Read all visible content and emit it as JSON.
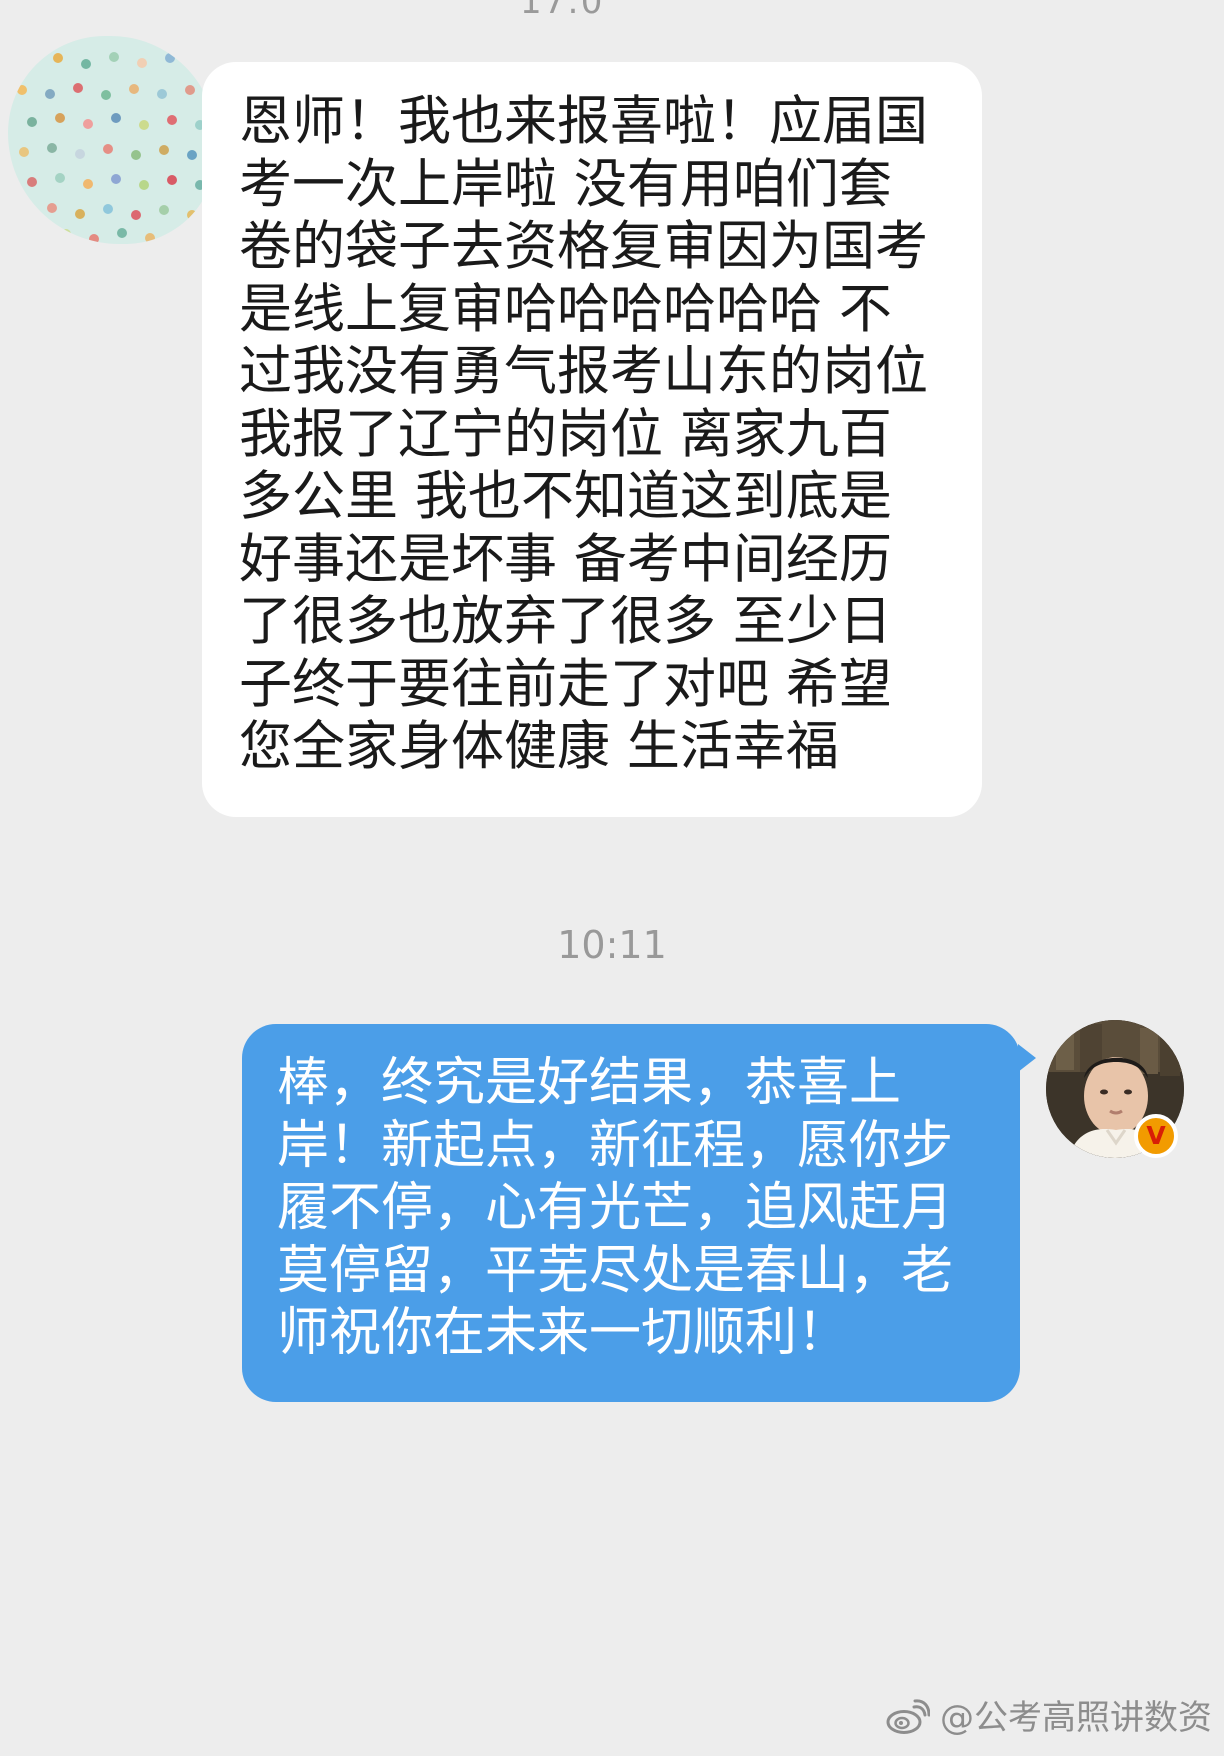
{
  "top_fragment": "17:0",
  "conversation": {
    "incoming": {
      "avatar": "polka-dot-avatar",
      "text": "恩师！我也来报喜啦！应届国考一次上岸啦 没有用咱们套卷的袋子去资格复审因为国考是线上复审哈哈哈哈哈哈 不过我没有勇气报考山东的岗位 我报了辽宁的岗位 离家九百多公里 我也不知道这到底是好事还是坏事 备考中间经历了很多也放弃了很多 至少日子终于要往前走了对吧 希望您全家身体健康 生活幸福"
    },
    "timestamp": "10:11",
    "outgoing": {
      "avatar": "teacher-avatar",
      "verified_badge": "V",
      "text": "棒，终究是好结果，恭喜上岸！新起点，新征程，愿你步履不停，心有光芒，追风赶月莫停留，平芜尽处是春山，老师祝你在未来一切顺利！"
    }
  },
  "watermark": {
    "icon": "weibo-icon",
    "text": "@公考高照讲数资"
  },
  "colors": {
    "background": "#ededed",
    "incoming_bubble": "#ffffff",
    "outgoing_bubble": "#4b9ee8",
    "timestamp": "#999999",
    "badge": "#f29b00"
  }
}
